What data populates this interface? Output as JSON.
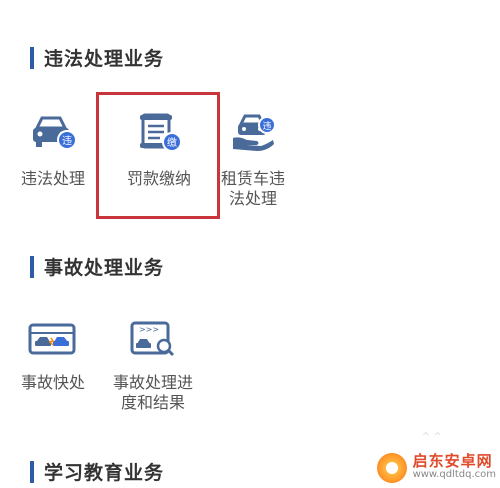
{
  "sections": [
    {
      "title": "违法处理业务",
      "items": [
        {
          "label": "违法处理",
          "icon": "car-violation-icon"
        },
        {
          "label": "罚款缴纳",
          "icon": "fine-payment-icon"
        },
        {
          "label": "租赁车违\n法处理",
          "icon": "rental-car-violation-icon"
        }
      ]
    },
    {
      "title": "事故处理业务",
      "items": [
        {
          "label": "事故快处",
          "icon": "accident-quick-icon"
        },
        {
          "label": "事故处理进\n度和结果",
          "icon": "accident-progress-icon"
        }
      ]
    },
    {
      "title": "学习教育业务",
      "items": []
    }
  ],
  "highlight_target": "罚款缴纳",
  "colors": {
    "accent": "#2f5aa8",
    "icon_primary": "#4a6a9a",
    "icon_badge": "#3a6fd8",
    "highlight": "#c8363c",
    "label": "#555555"
  },
  "watermark": {
    "title": "启东安卓网",
    "url": "www.qdltdq.com"
  }
}
